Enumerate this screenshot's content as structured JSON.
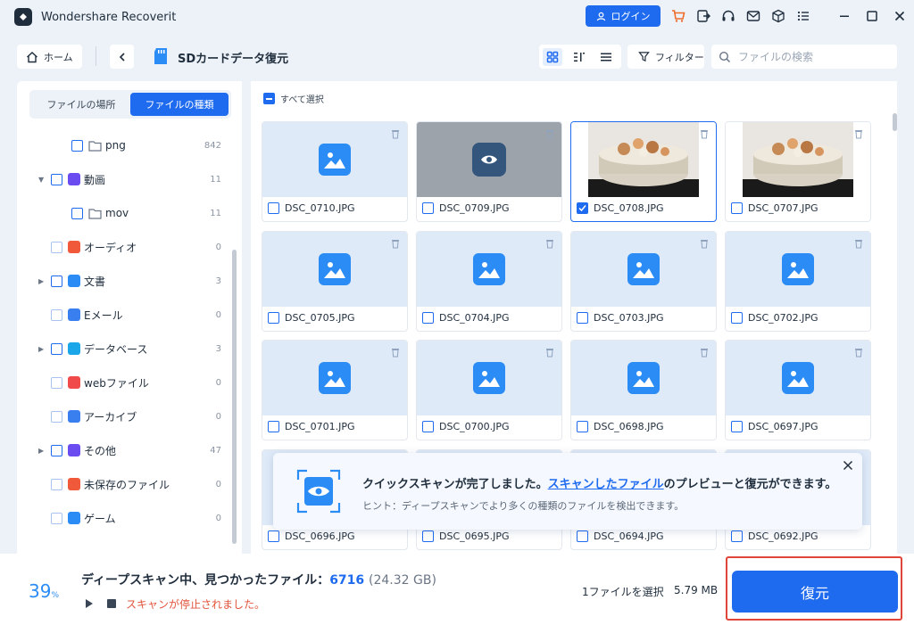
{
  "app": {
    "title": "Wondershare Recoverit",
    "login_label": "ログイン"
  },
  "toolbar": {
    "home_label": "ホーム",
    "location_title": "SDカードデータ復元",
    "filter_label": "フィルター",
    "search_placeholder": "ファイルの検索"
  },
  "sidebar": {
    "tabs": [
      {
        "label": "ファイルの場所",
        "active": false
      },
      {
        "label": "ファイルの種類",
        "active": true
      }
    ],
    "items": [
      {
        "label": "png",
        "count": "842"
      },
      {
        "label": "動画",
        "count": "11"
      },
      {
        "label": "mov",
        "count": "11"
      },
      {
        "label": "オーディオ",
        "count": "0"
      },
      {
        "label": "文書",
        "count": "3"
      },
      {
        "label": "Eメール",
        "count": "0"
      },
      {
        "label": "データベース",
        "count": "3"
      },
      {
        "label": "webファイル",
        "count": "0"
      },
      {
        "label": "アーカイブ",
        "count": "0"
      },
      {
        "label": "その他",
        "count": "47"
      },
      {
        "label": "未保存のファイル",
        "count": "0"
      },
      {
        "label": "ゲーム",
        "count": "0"
      }
    ]
  },
  "grid": {
    "select_all_label": "すべて選択",
    "files": [
      {
        "name": "DSC_0710.JPG",
        "thumb": "placeholder",
        "checked": false
      },
      {
        "name": "DSC_0709.JPG",
        "thumb": "preview-hover",
        "checked": false
      },
      {
        "name": "DSC_0708.JPG",
        "thumb": "photo",
        "checked": true
      },
      {
        "name": "DSC_0707.JPG",
        "thumb": "photo",
        "checked": false
      },
      {
        "name": "DSC_0705.JPG",
        "thumb": "placeholder",
        "checked": false
      },
      {
        "name": "DSC_0704.JPG",
        "thumb": "placeholder",
        "checked": false
      },
      {
        "name": "DSC_0703.JPG",
        "thumb": "placeholder",
        "checked": false
      },
      {
        "name": "DSC_0702.JPG",
        "thumb": "placeholder",
        "checked": false
      },
      {
        "name": "DSC_0701.JPG",
        "thumb": "placeholder",
        "checked": false
      },
      {
        "name": "DSC_0700.JPG",
        "thumb": "placeholder",
        "checked": false
      },
      {
        "name": "DSC_0698.JPG",
        "thumb": "placeholder",
        "checked": false
      },
      {
        "name": "DSC_0697.JPG",
        "thumb": "placeholder",
        "checked": false
      },
      {
        "name": "DSC_0696.JPG",
        "thumb": "placeholder",
        "checked": false
      },
      {
        "name": "DSC_0695.JPG",
        "thumb": "placeholder",
        "checked": false
      },
      {
        "name": "DSC_0694.JPG",
        "thumb": "placeholder",
        "checked": false
      },
      {
        "name": "DSC_0692.JPG",
        "thumb": "placeholder",
        "checked": false
      }
    ]
  },
  "notice": {
    "title_pre": "クイックスキャンが完了しました。",
    "title_link": "スキャンしたファイル",
    "title_post": "のプレビューと復元ができます。",
    "hint": "ヒント：ディープスキャンでより多くの種類のファイルを検出できます。"
  },
  "status": {
    "percent": "39",
    "percent_unit": "%",
    "scanning_label": "ディープスキャン中、見つかったファイル：",
    "found_count": "6716",
    "found_size": "(24.32 GB)",
    "stopped_message": "スキャンが停止されました。",
    "selected_label": "1ファイルを選択",
    "selected_size": "5.79 MB",
    "recover_label": "復元"
  },
  "colors": {
    "accent": "#1f6bef",
    "image_icon": "#2c8cf5",
    "warning": "#e2533a"
  }
}
